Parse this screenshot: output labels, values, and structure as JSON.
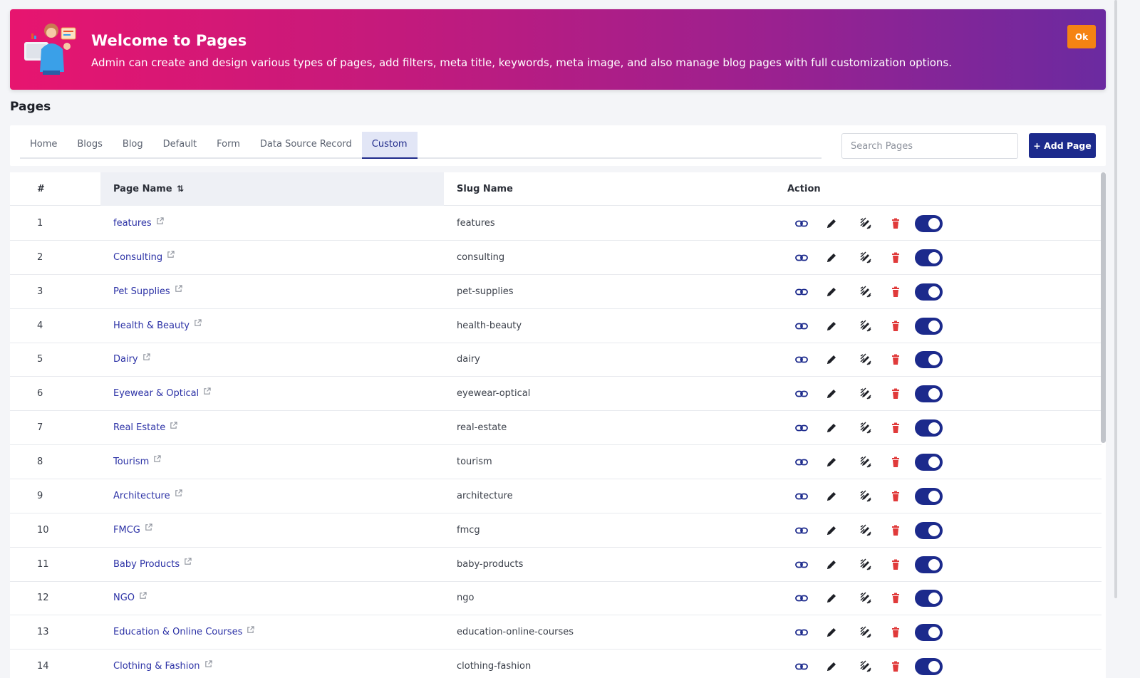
{
  "banner": {
    "title": "Welcome to Pages",
    "description": "Admin can create and design various types of pages, add filters, meta title, keywords, meta image, and also manage blog pages with full customization options.",
    "ok_label": "Ok"
  },
  "page_title": "Pages",
  "tabs": [
    {
      "label": "Home",
      "active": false
    },
    {
      "label": "Blogs",
      "active": false
    },
    {
      "label": "Blog",
      "active": false
    },
    {
      "label": "Default",
      "active": false
    },
    {
      "label": "Form",
      "active": false
    },
    {
      "label": "Data Source Record",
      "active": false
    },
    {
      "label": "Custom",
      "active": true
    }
  ],
  "search": {
    "placeholder": "Search Pages",
    "value": ""
  },
  "add_page_label": "+ Add Page",
  "table": {
    "headers": {
      "num": "#",
      "name": "Page Name",
      "slug": "Slug Name",
      "action": "Action"
    },
    "rows": [
      {
        "num": "1",
        "name": "features",
        "slug": "features",
        "enabled": true
      },
      {
        "num": "2",
        "name": "Consulting",
        "slug": "consulting",
        "enabled": true
      },
      {
        "num": "3",
        "name": "Pet Supplies",
        "slug": "pet-supplies",
        "enabled": true
      },
      {
        "num": "4",
        "name": "Health & Beauty",
        "slug": "health-beauty",
        "enabled": true
      },
      {
        "num": "5",
        "name": "Dairy",
        "slug": "dairy",
        "enabled": true
      },
      {
        "num": "6",
        "name": "Eyewear & Optical",
        "slug": "eyewear-optical",
        "enabled": true
      },
      {
        "num": "7",
        "name": "Real Estate",
        "slug": "real-estate",
        "enabled": true
      },
      {
        "num": "8",
        "name": "Tourism",
        "slug": "tourism",
        "enabled": true
      },
      {
        "num": "9",
        "name": "Architecture",
        "slug": "architecture",
        "enabled": true
      },
      {
        "num": "10",
        "name": "FMCG",
        "slug": "fmcg",
        "enabled": true
      },
      {
        "num": "11",
        "name": "Baby Products",
        "slug": "baby-products",
        "enabled": true
      },
      {
        "num": "12",
        "name": "NGO",
        "slug": "ngo",
        "enabled": true
      },
      {
        "num": "13",
        "name": "Education & Online Courses",
        "slug": "education-online-courses",
        "enabled": true
      },
      {
        "num": "14",
        "name": "Clothing & Fashion",
        "slug": "clothing-fashion",
        "enabled": true
      }
    ]
  },
  "icons": {
    "sort": "sort-icon",
    "external": "external-link-icon",
    "link": "link-icon",
    "edit": "pencil-icon",
    "design": "design-edit-icon",
    "delete": "trash-icon"
  },
  "colors": {
    "banner_start": "#e7156f",
    "banner_end": "#6b2aa0",
    "primary": "#1c2a8c",
    "ok_button": "#f58312",
    "link_text": "#2c32a6",
    "delete": "#e03a3a"
  }
}
